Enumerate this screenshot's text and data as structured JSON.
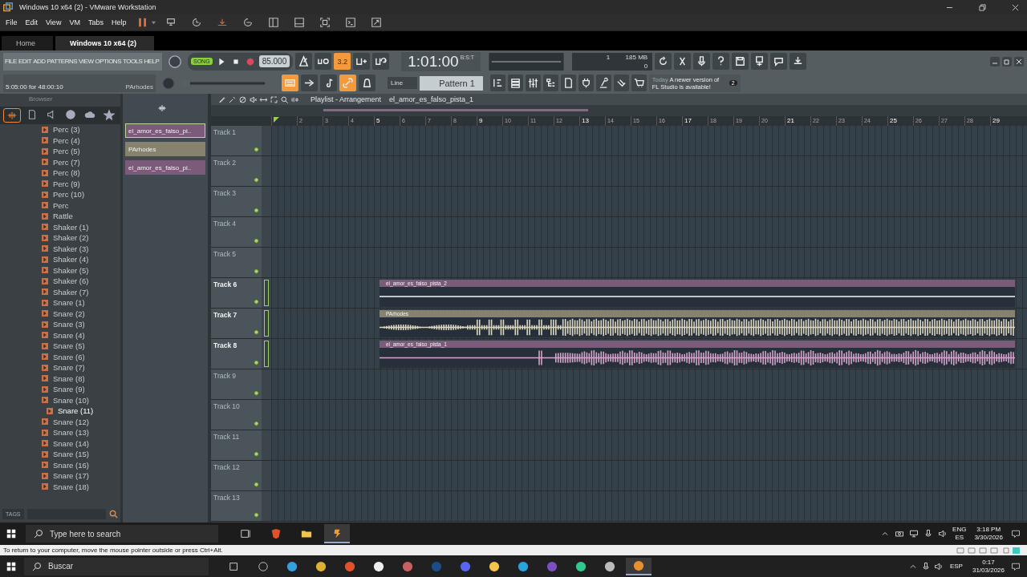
{
  "vm_window": {
    "title": "Windows 10 x64 (2) - VMware Workstation"
  },
  "vm_menu": [
    "File",
    "Edit",
    "View",
    "VM",
    "Tabs",
    "Help"
  ],
  "vm_tabs": [
    {
      "label": "Home",
      "selected": false
    },
    {
      "label": "Windows 10 x64 (2)",
      "selected": true
    }
  ],
  "fl_toolbar": {
    "menu": [
      "FILE",
      "EDIT",
      "ADD",
      "PATTERNS",
      "VIEW",
      "OPTIONS",
      "TOOLS",
      "HELP"
    ],
    "hint": "5:05:00 for 48:00:10",
    "hint_target": "PArhodes",
    "song_mode": {
      "label": "SONG",
      "on": true
    },
    "tempo": "85.000",
    "time": "1:01:00",
    "time_format": "B:S:T",
    "cpu": "1",
    "memory": "185 MB",
    "polyphony": "0",
    "snap": "Line",
    "pattern": "Pattern 1",
    "news_date": "Today",
    "news": "A newer version of FL Studio is available!",
    "news_count": "2",
    "master_pitch": {
      "level": 0
    },
    "buttons_top": [
      {
        "kind": "metronome",
        "on": false
      },
      {
        "kind": "wait",
        "on": false
      },
      {
        "kind": "countdown",
        "label": "3.2",
        "on": true
      },
      {
        "kind": "step",
        "on": false
      },
      {
        "kind": "loop",
        "on": false
      }
    ],
    "buttons_bottom": [
      {
        "kind": "typing",
        "on": true
      },
      {
        "kind": "arrow",
        "on": false
      },
      {
        "kind": "note",
        "on": false
      },
      {
        "kind": "link",
        "on": true
      },
      {
        "kind": "bell",
        "on": false
      }
    ]
  },
  "browser": {
    "title": "Browser",
    "tags_label": "TAGS",
    "items": [
      {
        "label": "Perc (3)",
        "selected": false
      },
      {
        "label": "Perc (4)",
        "selected": false
      },
      {
        "label": "Perc (5)",
        "selected": false
      },
      {
        "label": "Perc (7)",
        "selected": false
      },
      {
        "label": "Perc (8)",
        "selected": false
      },
      {
        "label": "Perc (9)",
        "selected": false
      },
      {
        "label": "Perc (10)",
        "selected": false
      },
      {
        "label": "Perc",
        "selected": false
      },
      {
        "label": "Rattle",
        "selected": false
      },
      {
        "label": "Shaker (1)",
        "selected": false
      },
      {
        "label": "Shaker (2)",
        "selected": false
      },
      {
        "label": "Shaker (3)",
        "selected": false
      },
      {
        "label": "Shaker (4)",
        "selected": false
      },
      {
        "label": "Shaker (5)",
        "selected": false
      },
      {
        "label": "Shaker (6)",
        "selected": false
      },
      {
        "label": "Shaker (7)",
        "selected": false
      },
      {
        "label": "Snare (1)",
        "selected": false
      },
      {
        "label": "Snare (2)",
        "selected": false
      },
      {
        "label": "Snare (3)",
        "selected": false
      },
      {
        "label": "Snare (4)",
        "selected": false
      },
      {
        "label": "Snare (5)",
        "selected": false
      },
      {
        "label": "Snare (6)",
        "selected": false
      },
      {
        "label": "Snare (7)",
        "selected": false
      },
      {
        "label": "Snare (8)",
        "selected": false
      },
      {
        "label": "Snare (9)",
        "selected": false
      },
      {
        "label": "Snare (10)",
        "selected": false
      },
      {
        "label": "Snare (11)",
        "selected": true
      },
      {
        "label": "Snare (12)",
        "selected": false
      },
      {
        "label": "Snare (13)",
        "selected": false
      },
      {
        "label": "Snare (14)",
        "selected": false
      },
      {
        "label": "Snare (15)",
        "selected": false
      },
      {
        "label": "Snare (16)",
        "selected": false
      },
      {
        "label": "Snare (17)",
        "selected": false
      },
      {
        "label": "Snare (18)",
        "selected": false
      }
    ]
  },
  "clip_picker": [
    {
      "label": "el_amor_es_falso_pi..",
      "color": "#7b5a7a",
      "selected": true
    },
    {
      "label": "PArhodes",
      "color": "#86826e",
      "selected": false
    },
    {
      "label": "el_amor_es_falso_pi..",
      "color": "#7b5a7a",
      "selected": false
    }
  ],
  "playlist": {
    "title": "Playlist - Arrangement",
    "breadcrumb": "el_amor_es_falso_pista_1",
    "ruler": [
      "2",
      "3",
      "4",
      "5",
      "6",
      "7",
      "8",
      "9",
      "10",
      "11",
      "12",
      "13",
      "14",
      "15",
      "16",
      "17",
      "18",
      "19",
      "20",
      "21",
      "22",
      "23",
      "24",
      "25",
      "26",
      "27",
      "28",
      "29"
    ],
    "tracks": [
      {
        "name": "Track 1",
        "active": false
      },
      {
        "name": "Track 2",
        "active": false
      },
      {
        "name": "Track 3",
        "active": false
      },
      {
        "name": "Track 4",
        "active": false
      },
      {
        "name": "Track 5",
        "active": false
      },
      {
        "name": "Track 6",
        "active": true,
        "clip": {
          "label": "el_amor_es_falso_pista_2",
          "color": "#7b5a7a",
          "kind": "flat"
        }
      },
      {
        "name": "Track 7",
        "active": true,
        "clip": {
          "label": "PArhodes",
          "color": "#86826e",
          "kind": "dense"
        }
      },
      {
        "name": "Track 8",
        "active": true,
        "clip": {
          "label": "el_amor_es_falso_pista_1",
          "color": "#7b5a7a",
          "kind": "late"
        }
      },
      {
        "name": "Track 9",
        "active": false
      },
      {
        "name": "Track 10",
        "active": false
      },
      {
        "name": "Track 11",
        "active": false
      },
      {
        "name": "Track 12",
        "active": false
      },
      {
        "name": "Track 13",
        "active": false
      }
    ]
  },
  "guest_taskbar": {
    "search_placeholder": "Type here to search",
    "lang": "ENG",
    "lang_sub": "ES",
    "time": "3:18 PM",
    "date": "3/30/2026"
  },
  "vm_status": "To return to your computer, move the mouse pointer outside or press Ctrl+Alt.",
  "host_taskbar": {
    "search_placeholder": "Buscar",
    "lang": "ESP",
    "time": "0:17",
    "date": "31/03/2026"
  }
}
